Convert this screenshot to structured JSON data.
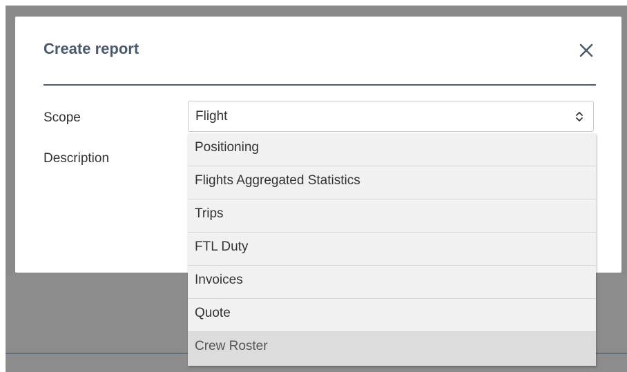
{
  "modal": {
    "title": "Create report"
  },
  "form": {
    "scope_label": "Scope",
    "description_label": "Description",
    "scope_value": "Flight"
  },
  "dropdown": {
    "options": [
      {
        "label": "Positioning"
      },
      {
        "label": "Flights Aggregated Statistics"
      },
      {
        "label": "Trips"
      },
      {
        "label": "FTL Duty"
      },
      {
        "label": "Invoices"
      },
      {
        "label": "Quote"
      },
      {
        "label": "Crew Roster"
      }
    ],
    "hovered_option": "Crew Roster"
  },
  "colors": {
    "title": "#4a5a6e",
    "overlay": "#8a8a8a",
    "dropdown_bg": "#f1f1f1",
    "hover_bg": "#dcdcdc"
  },
  "icons": {
    "close": "close-icon",
    "select_arrows": "select-arrows-icon"
  }
}
